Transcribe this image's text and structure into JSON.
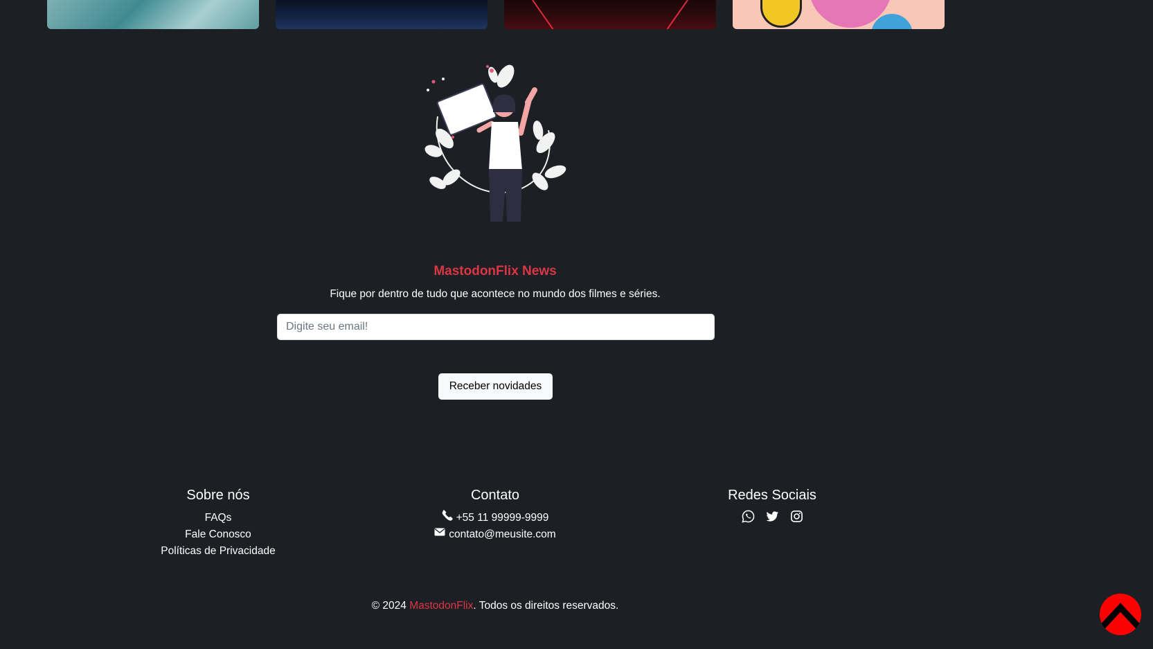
{
  "newsletter": {
    "title": "MastodonFlix News",
    "description": "Fique por dentro de tudo que acontece no mundo dos filmes e séries.",
    "email_placeholder": "Digite seu email!",
    "subscribe_label": "Receber novidades"
  },
  "footer": {
    "about": {
      "title": "Sobre nós",
      "links": [
        "FAQs",
        "Fale Conosco",
        "Políticas de Privacidade"
      ]
    },
    "contact": {
      "title": "Contato",
      "phone": "+55 11 99999-9999",
      "email": "contato@meusite.com"
    },
    "social": {
      "title": "Redes Sociais",
      "icons": [
        "whatsapp-icon",
        "twitter-icon",
        "instagram-icon"
      ]
    }
  },
  "copyright": {
    "prefix": "© 2024 ",
    "brand": "MastodonFlix",
    "suffix": ". Todos os direitos reservados."
  },
  "colors": {
    "background": "#1c1f23",
    "accent": "#dc3545",
    "back_to_top": "#ff0000"
  }
}
